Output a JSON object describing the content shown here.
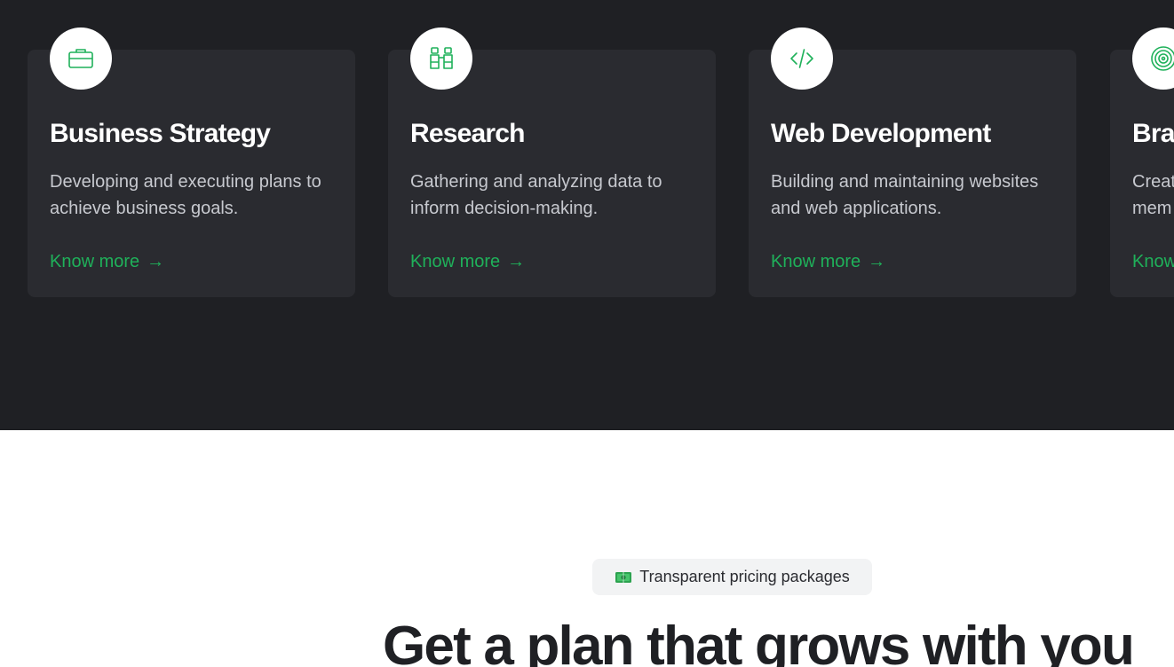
{
  "services": {
    "cards": [
      {
        "title": "Business Strategy",
        "description": "Developing and executing plans to achieve business goals.",
        "link": "Know more",
        "icon": "briefcase-icon"
      },
      {
        "title": "Research",
        "description": "Gathering and analyzing data to inform decision-making.",
        "link": "Know more",
        "icon": "binoculars-icon"
      },
      {
        "title": "Web Development",
        "description": "Building and maintaining websites and web applications.",
        "link": "Know more",
        "icon": "code-icon"
      },
      {
        "title": "Bra",
        "description_line1": "Creat",
        "description_line2": "mem",
        "link": "Know",
        "icon": "target-icon"
      }
    ],
    "link_arrow": "→"
  },
  "pricing": {
    "badge_label": "Transparent pricing packages",
    "badge_icon": "money-icon",
    "headline": "Get a plan that grows with you"
  },
  "colors": {
    "dark_bg": "#1f2024",
    "card_bg": "#2a2b30",
    "accent": "#1fb15a"
  }
}
